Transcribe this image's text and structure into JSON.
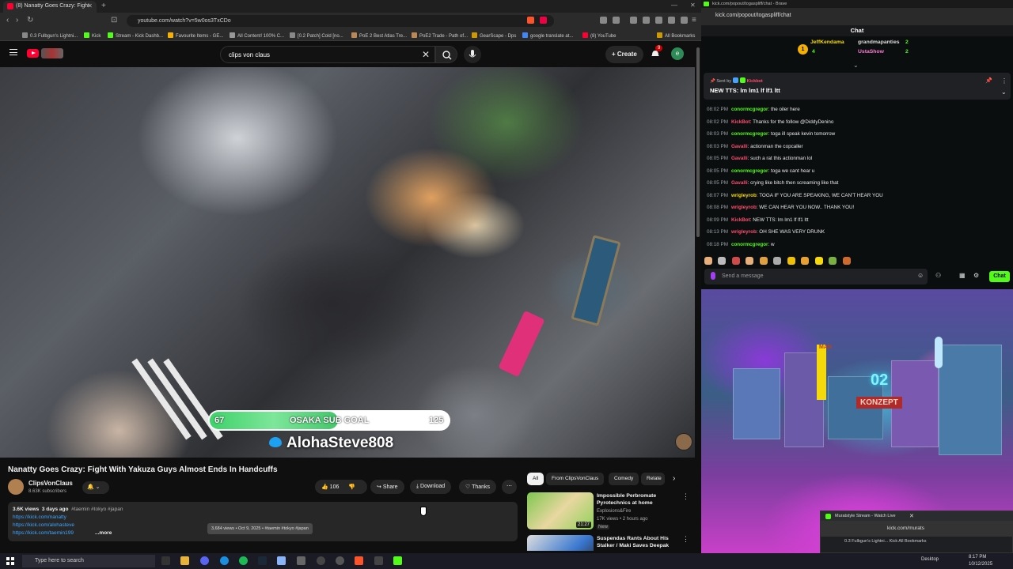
{
  "left_browser": {
    "tab_title": "(8) Nanatty Goes Crazy: Fight",
    "url": "youtube.com/watch?v=5w0os3TxCDo",
    "bookmarks": [
      "0.3 Fulbgun's Lightni...",
      "Kick",
      "Stream - Kick Dashb...",
      "Favourite Items - GE...",
      "All Content! 100% C...",
      "[0.2 Patch] Cold [no...",
      "PoE 2 Best Atlas Tre...",
      "PoE2 Trade - Path of...",
      "GearScape - Dps",
      "google translate at...",
      "(8) YouTube",
      "All Bookmarks"
    ]
  },
  "youtube": {
    "search_value": "clips von claus",
    "create_label": "Create",
    "notif_count": "9",
    "avatar_letter": "e",
    "goal": {
      "label": "OSAKA SUB GOAL",
      "current": "67",
      "target": "125",
      "progress": 0.536
    },
    "twitter_handle": "AlohaSteve808",
    "video_title": "Nanatty Goes Crazy: Fight With Yakuza Guys Almost Ends In Handcuffs",
    "channel_name": "ClipsVonClaus",
    "subscribers": "8.63K subscribers",
    "likes": "106",
    "share_label": "Share",
    "download_label": "Download",
    "thanks_label": "Thanks",
    "views": "3.6K views",
    "age": "3 days ago",
    "tags": "#taemin #tokyo #japan",
    "links": [
      "https://kick.com/nanatty",
      "https://kick.com/alohasteve",
      "https://kick.com/taemin199"
    ],
    "more_label": "...more",
    "tooltip": "3,684 views • Oct 9, 2025 • #taemin #tokyo #japan",
    "chips": [
      "All",
      "From ClipsVonClaus",
      "Comedy",
      "Relate"
    ],
    "recommendations": [
      {
        "title": "Impossible Perbromate Pyrotechnics at home",
        "channel": "Explosions&Fire",
        "meta": "17K views • 2 hours ago",
        "badge": "New",
        "duration": "21:27"
      },
      {
        "title": "Suspendas Rants About His Stalker / Maki Saves Deepak",
        "channel": "",
        "meta": "",
        "badge": "",
        "duration": ""
      }
    ]
  },
  "kick_chat": {
    "tab_title": "kick.com/popout/togaspliff/chat - Brave",
    "url": "kick.com/popout/togaspliff/chat",
    "header": "Chat",
    "leaderboard": [
      {
        "name": "JeffKendama",
        "count": "4"
      },
      {
        "name": "grandmapanties",
        "count": "2"
      },
      {
        "name": "UstaShow",
        "count": "2"
      }
    ],
    "pinned_by": "Sent by",
    "pinned_user": "Kickbot",
    "pinned_message": "NEW TTS: lm lm1 lf lf1 ltt",
    "messages": [
      {
        "time": "08:02 PM",
        "user": "conormcgregor",
        "text": "the oiler here",
        "color": "#53fc18"
      },
      {
        "time": "08:02 PM",
        "user": "KickBot",
        "text": "Thanks for the follow @DiddyDenino",
        "color": "#ff4d6d"
      },
      {
        "time": "08:03 PM",
        "user": "conormcgregor",
        "text": "toga ill speak kevin tomorrow",
        "color": "#53fc18"
      },
      {
        "time": "08:03 PM",
        "user": "Gavalli",
        "text": "actionman the copcaller",
        "color": "#ff4d6d"
      },
      {
        "time": "08:05 PM",
        "user": "Gavalli",
        "text": "such a rat this actionman lol",
        "color": "#ff4d6d"
      },
      {
        "time": "08:05 PM",
        "user": "conormcgregor",
        "text": "toga we cant hear u",
        "color": "#53fc18"
      },
      {
        "time": "08:05 PM",
        "user": "Gavalli",
        "text": "crying like bitch then screaming like that",
        "color": "#ff4d6d"
      },
      {
        "time": "08:07 PM",
        "user": "wrigleyrob",
        "text": "TOGA IF YOU ARE SPEAKING, WE CAN'T HEAR YOU",
        "color": "#f5d90a"
      },
      {
        "time": "08:08 PM",
        "user": "wrigleyrob",
        "text": "WE CAN HEAR YOU NOW.. THANK YOU!",
        "color": "#ff4d6d"
      },
      {
        "time": "08:09 PM",
        "user": "KickBot",
        "text": "NEW TTS: lm lm1 lf lf1 ltt",
        "color": "#ff4d6d"
      },
      {
        "time": "08:13 PM",
        "user": "wrigleyrob",
        "text": "OH SHE WAS VERY DRUNK",
        "color": "#ff4d6d"
      },
      {
        "time": "08:18 PM",
        "user": "conormcgregor",
        "text": "w",
        "color": "#53fc18"
      }
    ],
    "input_placeholder": "Send a message",
    "chat_button": "Chat"
  },
  "stream": {
    "mini_window_title": "Muratstyle Stream - Watch Live",
    "mini_url": "kick.com/murats",
    "mini_bookmarks": "0.3 Fulbgun's Lightni...   Kick   All Bookmarks",
    "sign_1": "MAN",
    "sign_2": "02",
    "sign_3": "KONZEPT"
  },
  "taskbar": {
    "search_placeholder": "Type here to search",
    "desktop_label": "Desktop",
    "time": "8:17 PM",
    "date": "10/12/2025"
  },
  "colors": {
    "youtube_red": "#ff0033",
    "kick_green": "#53fc18",
    "link_blue": "#3ea6ff"
  }
}
